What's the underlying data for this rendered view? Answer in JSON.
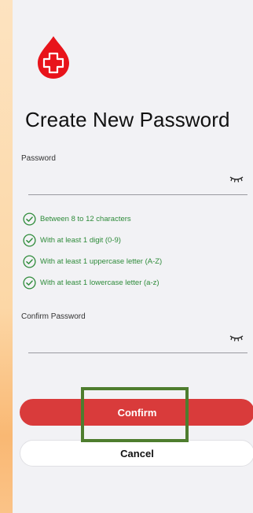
{
  "colors": {
    "brand": "#d93b3b",
    "valid": "#2e8b3a",
    "highlight": "#4e7d2e"
  },
  "logo": {
    "icon": "blood-drop-cross-icon"
  },
  "title": "Create New Password",
  "password": {
    "label": "Password",
    "value": "",
    "icon": "eye-closed-icon"
  },
  "rules": [
    {
      "text": "Between 8 to 12 characters",
      "status": "valid"
    },
    {
      "text": "With at least 1 digit (0-9)",
      "status": "valid"
    },
    {
      "text": "With at least 1 uppercase letter (A-Z)",
      "status": "valid"
    },
    {
      "text": "With at least 1 lowercase letter (a-z)",
      "status": "valid"
    }
  ],
  "confirm_password": {
    "label": "Confirm Password",
    "value": "",
    "icon": "eye-closed-icon"
  },
  "actions": {
    "confirm_label": "Confirm",
    "cancel_label": "Cancel"
  }
}
